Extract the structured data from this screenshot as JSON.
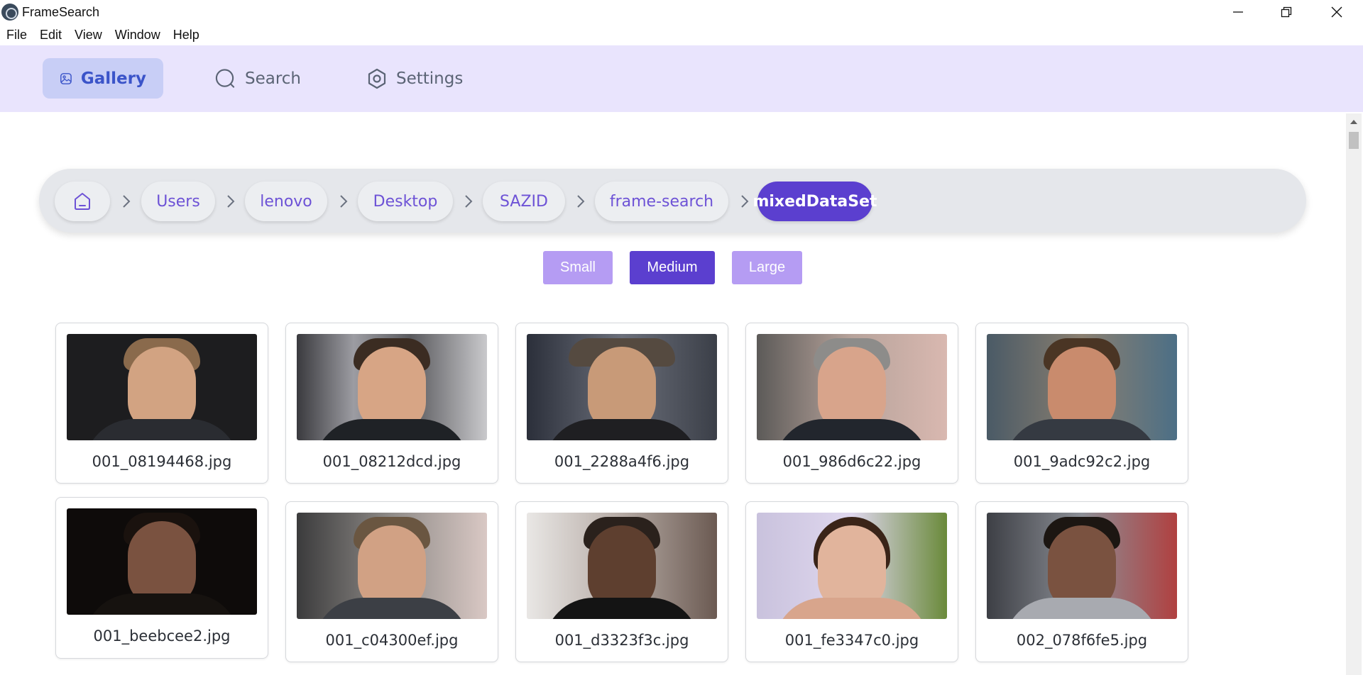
{
  "app": {
    "title": "FrameSearch"
  },
  "menu": [
    "File",
    "Edit",
    "View",
    "Window",
    "Help"
  ],
  "nav": {
    "gallery": "Gallery",
    "search": "Search",
    "settings": "Settings"
  },
  "breadcrumb": [
    "Users",
    "lenovo",
    "Desktop",
    "SAZID",
    "frame-search",
    "mixedDataSet"
  ],
  "sizes": [
    "Small",
    "Medium",
    "Large"
  ],
  "selected_size": "Medium",
  "images": [
    "001_08194468.jpg",
    "001_08212dcd.jpg",
    "001_2288a4f6.jpg",
    "001_986d6c22.jpg",
    "001_9adc92c2.jpg",
    "001_beebcee2.jpg",
    "001_c04300ef.jpg",
    "001_d3323f3c.jpg",
    "001_fe3347c0.jpg",
    "002_078f6fe5.jpg"
  ]
}
